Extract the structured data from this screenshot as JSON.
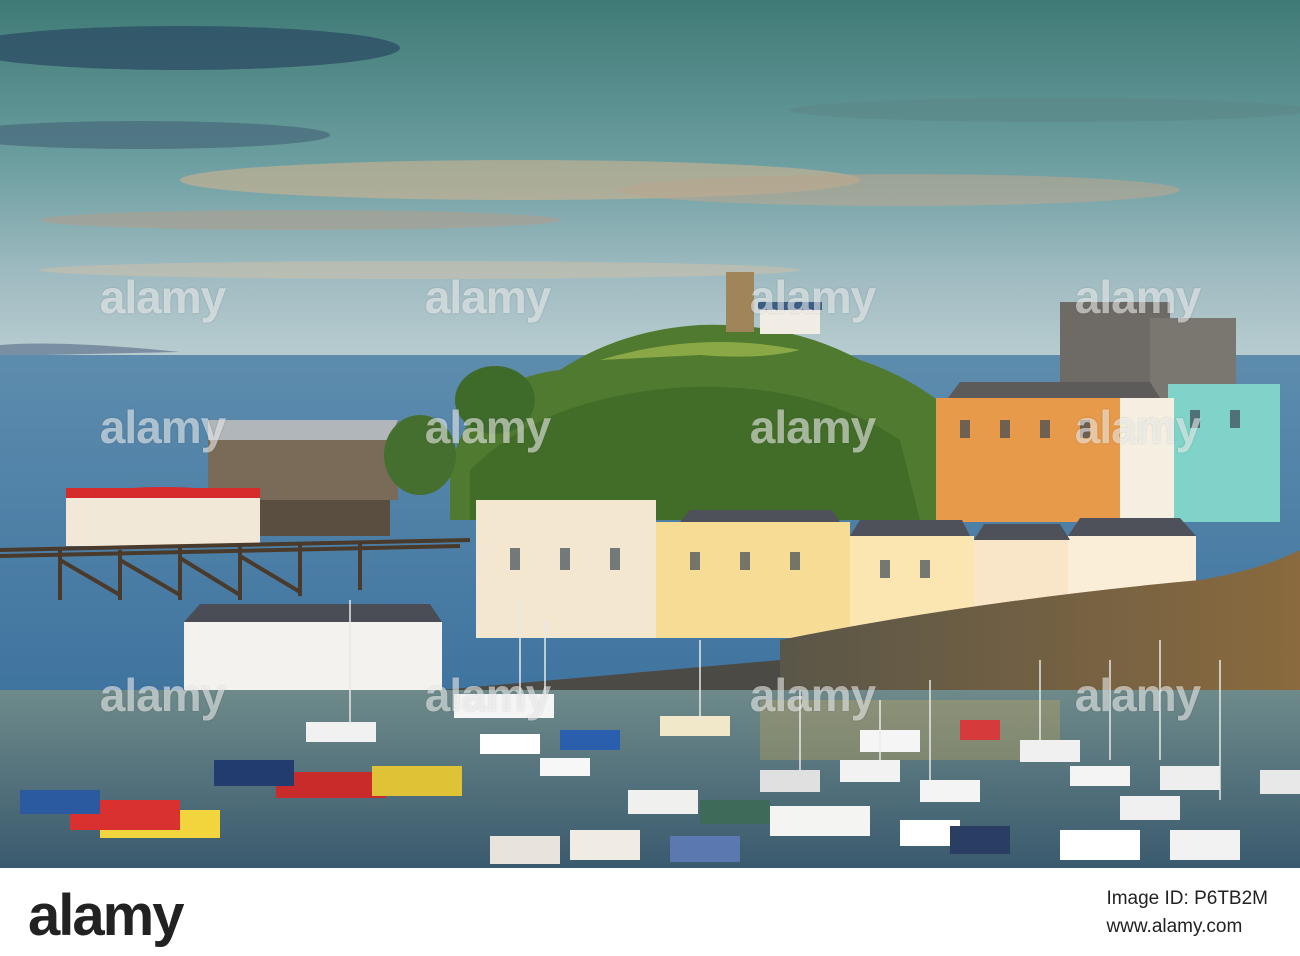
{
  "photo": {
    "subject": "Harbour town at sunset with hill, lifeboat station, colourful houses and moored boats",
    "watermark_text": "alamy"
  },
  "footer": {
    "logo_text": "alamy",
    "image_id_label": "Image ID: P6TB2M",
    "site_label": "www.alamy.com"
  }
}
